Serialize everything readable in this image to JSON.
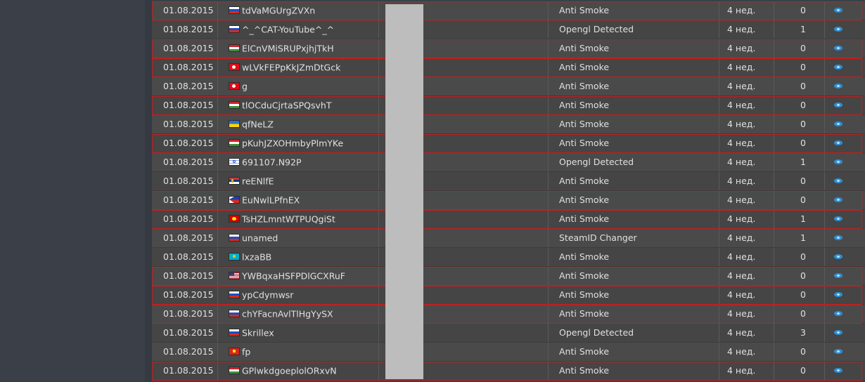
{
  "rows": [
    {
      "date": "01.08.2015",
      "flag": "ru",
      "name": "tdVaMGUrgZVXn",
      "type": "Anti Smoke",
      "ago": "4 нед.",
      "count": "0",
      "flagged": true
    },
    {
      "date": "01.08.2015",
      "flag": "ru",
      "name": "^_^CAT-YouTube^_^",
      "type": "Opengl Detected",
      "ago": "4 нед.",
      "count": "1",
      "flagged": false
    },
    {
      "date": "01.08.2015",
      "flag": "hu",
      "name": "ElCnVMiSRUPxjhjTkH",
      "type": "Anti Smoke",
      "ago": "4 нед.",
      "count": "0",
      "flagged": true
    },
    {
      "date": "01.08.2015",
      "flag": "tr",
      "name": "wLVkFEPpKkJZmDtGck",
      "type": "Anti Smoke",
      "ago": "4 нед.",
      "count": "0",
      "flagged": true
    },
    {
      "date": "01.08.2015",
      "flag": "tr",
      "name": "g",
      "type": "Anti Smoke",
      "ago": "4 нед.",
      "count": "0",
      "flagged": false
    },
    {
      "date": "01.08.2015",
      "flag": "hu",
      "name": "tlOCduCjrtaSPQsvhT",
      "type": "Anti Smoke",
      "ago": "4 нед.",
      "count": "0",
      "flagged": true
    },
    {
      "date": "01.08.2015",
      "flag": "ua",
      "name": "qfNeLZ",
      "type": "Anti Smoke",
      "ago": "4 нед.",
      "count": "0",
      "flagged": false
    },
    {
      "date": "01.08.2015",
      "flag": "hu",
      "name": "pKuhJZXOHmbyPlmYKe",
      "type": "Anti Smoke",
      "ago": "4 нед.",
      "count": "0",
      "flagged": true
    },
    {
      "date": "01.08.2015",
      "flag": "il",
      "name": "691107.N92P",
      "type": "Opengl Detected",
      "ago": "4 нед.",
      "count": "1",
      "flagged": false
    },
    {
      "date": "01.08.2015",
      "flag": "rs",
      "name": "reENlfE",
      "type": "Anti Smoke",
      "ago": "4 нед.",
      "count": "0",
      "flagged": false
    },
    {
      "date": "01.08.2015",
      "flag": "ph",
      "name": "EuNwlLPfnEX",
      "type": "Anti Smoke",
      "ago": "4 нед.",
      "count": "0",
      "flagged": true
    },
    {
      "date": "01.08.2015",
      "flag": "mk",
      "name": "TsHZLmntWTPUQgiSt",
      "type": "Anti Smoke",
      "ago": "4 нед.",
      "count": "1",
      "flagged": true
    },
    {
      "date": "01.08.2015",
      "flag": "ru",
      "name": "unamed",
      "type": "SteamID Changer",
      "ago": "4 нед.",
      "count": "1",
      "flagged": false
    },
    {
      "date": "01.08.2015",
      "flag": "kz",
      "name": "lxzaBB",
      "type": "Anti Smoke",
      "ago": "4 нед.",
      "count": "0",
      "flagged": false
    },
    {
      "date": "01.08.2015",
      "flag": "us",
      "name": "YWBqxaHSFPDlGCXRuF",
      "type": "Anti Smoke",
      "ago": "4 нед.",
      "count": "0",
      "flagged": true
    },
    {
      "date": "01.08.2015",
      "flag": "ru",
      "name": "ypCdymwsr",
      "type": "Anti Smoke",
      "ago": "4 нед.",
      "count": "0",
      "flagged": true
    },
    {
      "date": "01.08.2015",
      "flag": "ru",
      "name": "chYFacnAvlTlHgYySX",
      "type": "Anti Smoke",
      "ago": "4 нед.",
      "count": "0",
      "flagged": true
    },
    {
      "date": "01.08.2015",
      "flag": "ru",
      "name": "Skrillex",
      "type": "Opengl Detected",
      "ago": "4 нед.",
      "count": "3",
      "flagged": false
    },
    {
      "date": "01.08.2015",
      "flag": "vn",
      "name": "fp",
      "type": "Anti Smoke",
      "ago": "4 нед.",
      "count": "0",
      "flagged": false
    },
    {
      "date": "01.08.2015",
      "flag": "hu",
      "name": "GPlwkdgoeplolORxvN",
      "type": "Anti Smoke",
      "ago": "4 нед.",
      "count": "0",
      "flagged": true
    }
  ],
  "icons": {
    "view": "eye-icon"
  },
  "colors": {
    "highlight_border": "#c21f1f",
    "eye": "#2d8fd5"
  }
}
